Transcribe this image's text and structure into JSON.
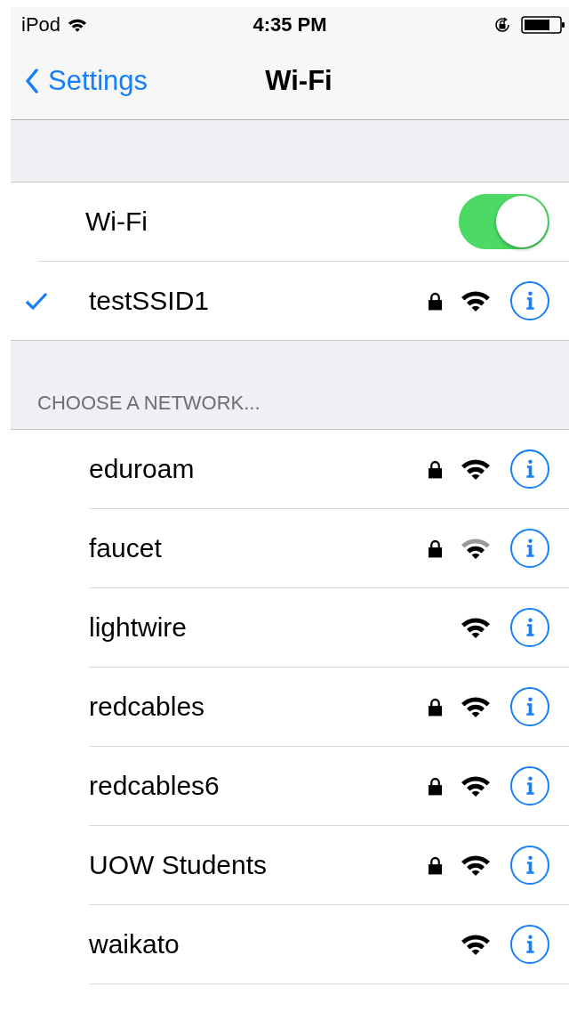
{
  "status_bar": {
    "device": "iPod",
    "time": "4:35 PM"
  },
  "nav": {
    "back": "Settings",
    "title": "Wi-Fi"
  },
  "wifi_toggle": {
    "label": "Wi-Fi",
    "on": true
  },
  "connected": {
    "name": "testSSID1",
    "selected": true,
    "secured": true,
    "weak": false
  },
  "section_header": "CHOOSE A NETWORK...",
  "networks": [
    {
      "name": "eduroam",
      "secured": true,
      "weak": false
    },
    {
      "name": "faucet",
      "secured": true,
      "weak": true
    },
    {
      "name": "lightwire",
      "secured": false,
      "weak": false
    },
    {
      "name": "redcables",
      "secured": true,
      "weak": false
    },
    {
      "name": "redcables6",
      "secured": true,
      "weak": false
    },
    {
      "name": "UOW Students",
      "secured": true,
      "weak": false
    },
    {
      "name": "waikato",
      "secured": false,
      "weak": false
    }
  ]
}
